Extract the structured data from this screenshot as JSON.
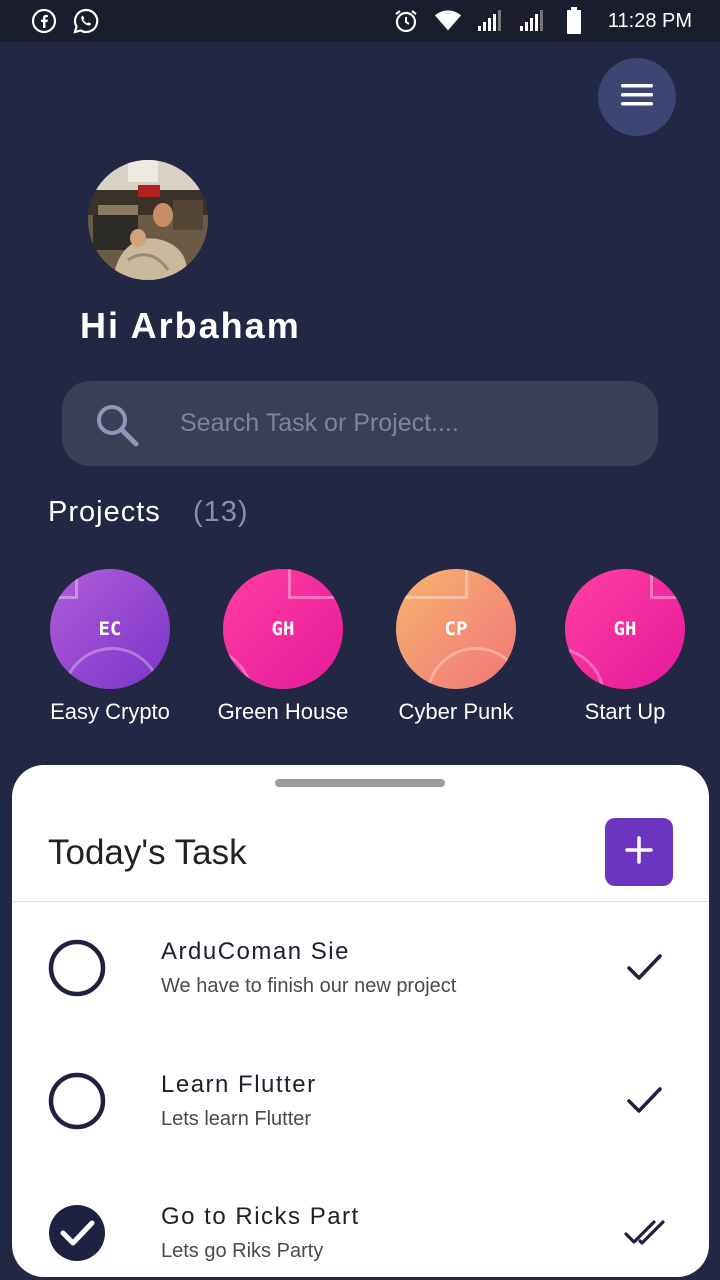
{
  "status_bar": {
    "left_icons": [
      "facebook-icon",
      "whatsapp-icon"
    ],
    "right_icons": [
      "alarm-icon",
      "wifi-icon",
      "signal-icon",
      "signal-icon-2",
      "battery-icon"
    ],
    "time": "11:28 PM"
  },
  "header": {
    "menu_icon": "hamburger-menu-icon",
    "greeting": "Hi Arbaham"
  },
  "search": {
    "placeholder": "Search Task or Project...."
  },
  "projects": {
    "title": "Projects",
    "count": "(13)",
    "items": [
      {
        "initials": "EC",
        "name": "Easy Crypto",
        "gradient": [
          "#b05ed8",
          "#7a34c9"
        ]
      },
      {
        "initials": "GH",
        "name": "Green House",
        "gradient": [
          "#ff3fa0",
          "#e6199b"
        ]
      },
      {
        "initials": "CP",
        "name": "Cyber Punk",
        "gradient": [
          "#f7b46c",
          "#f0757a"
        ]
      },
      {
        "initials": "GH",
        "name": "Start Up",
        "gradient": [
          "#ff3fa0",
          "#e6199b"
        ]
      }
    ]
  },
  "today": {
    "title": "Today's Task",
    "add_icon": "plus-icon",
    "accent": "#6c35c0",
    "tasks": [
      {
        "title": "ArduComan Sie",
        "subtitle": "We have to finish our new project",
        "done": false,
        "status_icon": "check-icon"
      },
      {
        "title": "Learn Flutter",
        "subtitle": "Lets learn Flutter",
        "done": false,
        "status_icon": "check-icon"
      },
      {
        "title": "Go to Ricks Part",
        "subtitle": "Lets go Riks Party",
        "done": true,
        "status_icon": "double-check-icon"
      }
    ]
  }
}
